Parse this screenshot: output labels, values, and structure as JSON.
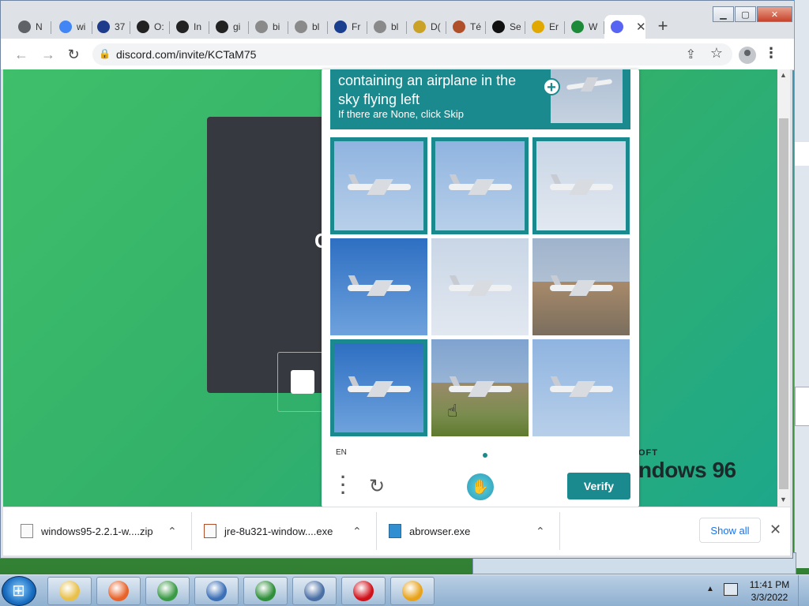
{
  "browser": {
    "tabs": [
      {
        "icon": "chrome-icon",
        "title": "N",
        "color": "#5f6368"
      },
      {
        "icon": "google-icon",
        "title": "wi",
        "color": "#4285f4"
      },
      {
        "icon": "mp-icon",
        "title": "37",
        "color": "#1e3a8a"
      },
      {
        "icon": "museum-icon",
        "title": "O:",
        "color": "#222222"
      },
      {
        "icon": "museum-icon",
        "title": "In",
        "color": "#222222"
      },
      {
        "icon": "museum-icon",
        "title": "gi",
        "color": "#222222"
      },
      {
        "icon": "globe-icon",
        "title": "bi",
        "color": "#8a8a8a"
      },
      {
        "icon": "globe-icon",
        "title": "bl",
        "color": "#8a8a8a"
      },
      {
        "icon": "s-icon",
        "title": "Fr",
        "color": "#1a3f8f"
      },
      {
        "icon": "globe-icon",
        "title": "bl",
        "color": "#8a8a8a"
      },
      {
        "icon": "badge-icon",
        "title": "D(",
        "color": "#c9a227"
      },
      {
        "icon": "java-icon",
        "title": "Té",
        "color": "#b0502a"
      },
      {
        "icon": "github-icon",
        "title": "Se",
        "color": "#111111"
      },
      {
        "icon": "warning-icon",
        "title": "Er",
        "color": "#e0a800"
      },
      {
        "icon": "sheet-icon",
        "title": "W",
        "color": "#1d8a3a"
      },
      {
        "icon": "discord-icon",
        "title": "",
        "color": "#5865f2",
        "active": true
      }
    ],
    "url": "discord.com/invite/KCTaM75"
  },
  "page": {
    "win96_small": "OFT",
    "win96_big": "ndows 96"
  },
  "captcha": {
    "prompt": "containing an airplane in the sky flying left",
    "hint": "If there are None, click Skip",
    "lang": "EN",
    "verify_label": "Verify",
    "accent": "#1a8a8e",
    "tiles": [
      {
        "selected": true,
        "scene": "sky"
      },
      {
        "selected": true,
        "scene": "sky"
      },
      {
        "selected": true,
        "scene": "sky-light"
      },
      {
        "selected": false,
        "scene": "sky-deep"
      },
      {
        "selected": false,
        "scene": "sky-light"
      },
      {
        "selected": false,
        "scene": "runway"
      },
      {
        "selected": true,
        "scene": "sky-deep"
      },
      {
        "selected": false,
        "scene": "runway-grass"
      },
      {
        "selected": false,
        "scene": "sky"
      }
    ]
  },
  "downloads": {
    "items": [
      {
        "name": "windows95-2.2.1-w....zip",
        "icon": "file-icon"
      },
      {
        "name": "jre-8u321-window....exe",
        "icon": "java-installer-icon"
      },
      {
        "name": "abrowser.exe",
        "icon": "installer-icon"
      }
    ],
    "show_all_label": "Show all"
  },
  "taskbar": {
    "clock_time": "11:41 PM",
    "clock_date": "3/3/2022",
    "apps": [
      {
        "name": "explorer-icon",
        "color": "#e8c04a"
      },
      {
        "name": "firefox-icon",
        "color": "#e8632a"
      },
      {
        "name": "chrome-icon",
        "color": "#3a9a45"
      },
      {
        "name": "remote-desktop-icon",
        "color": "#3b6fb6"
      },
      {
        "name": "download-globe-icon",
        "color": "#2f8f3a"
      },
      {
        "name": "shield-icon",
        "color": "#4a6fa5"
      },
      {
        "name": "opera-icon",
        "color": "#d0121b"
      },
      {
        "name": "vpn-icon",
        "color": "#e8a31a"
      }
    ]
  }
}
